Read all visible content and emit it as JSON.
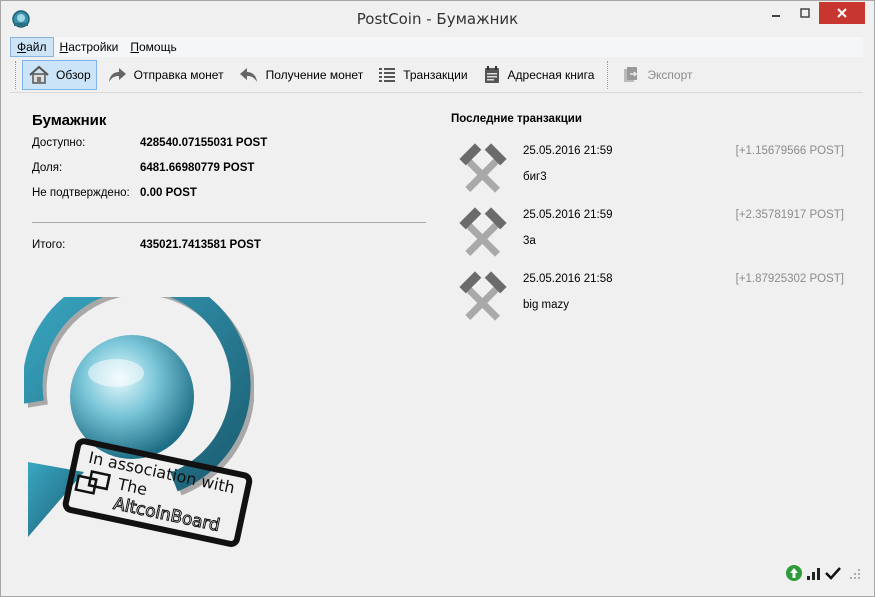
{
  "window": {
    "title": "PostCoin - Бумажник"
  },
  "menu": {
    "items": [
      {
        "key": "file",
        "accel": "Ф",
        "rest": "айл"
      },
      {
        "key": "settings",
        "accel": "Н",
        "rest": "астройки"
      },
      {
        "key": "help",
        "accel": "П",
        "rest": "омощь"
      }
    ]
  },
  "toolbar": {
    "overview": "Обзор",
    "send": "Отправка монет",
    "receive": "Получение монет",
    "transactions": "Транзакции",
    "address_book": "Адресная книга",
    "export": "Экспорт"
  },
  "wallet": {
    "title": "Бумажник",
    "available_label": "Доступно:",
    "available_value": "428540.07155031 POST",
    "stake_label": "Доля:",
    "stake_value": "6481.66980779 POST",
    "unconfirmed_label": "Не подтверждено:",
    "unconfirmed_value": "0.00 POST",
    "total_label": "Итого:",
    "total_value": "435021.7413581 POST"
  },
  "recent": {
    "title": "Последние транзакции",
    "transactions": [
      {
        "date": "25.05.2016 21:59",
        "amount": "[+1.15679566 POST]",
        "label": "биг3"
      },
      {
        "date": "25.05.2016 21:59",
        "amount": "[+2.35781917 POST]",
        "label": "3а"
      },
      {
        "date": "25.05.2016 21:58",
        "amount": "[+1.87925302 POST]",
        "label": "big mazy"
      }
    ]
  },
  "watermark": {
    "text": "In association with The AltcoinBoard"
  },
  "colors": {
    "close_button": "#c7372f",
    "toolbar_active": "#cce4f7",
    "amount_text": "#8c8c8c",
    "logo_teal": "#2a8ba6"
  },
  "icons": {
    "status_sync": "green-arrow-up-icon",
    "status_connections": "signal-bars-icon",
    "status_synced": "checkmark-icon"
  }
}
